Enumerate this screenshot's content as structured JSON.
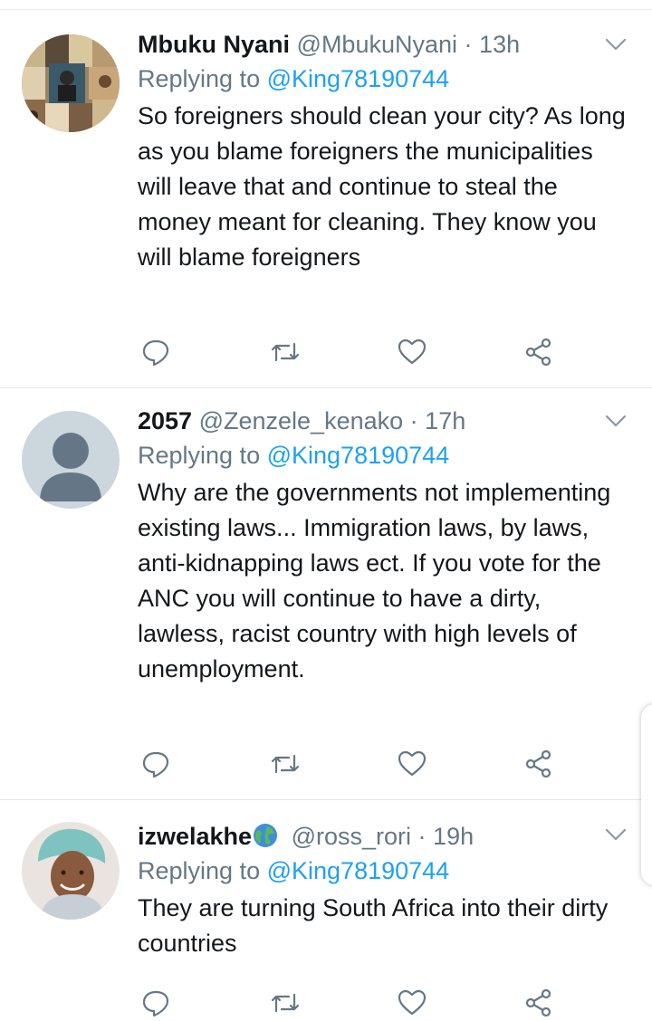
{
  "colors": {
    "link": "#1da1f2",
    "secondary_text": "#657786",
    "primary_text": "#14171a",
    "divider": "#e1e8ed"
  },
  "icons": {
    "reply": "reply-icon",
    "retweet": "retweet-icon",
    "like": "heart-icon",
    "share": "share-icon",
    "more": "chevron-down-icon"
  },
  "tweets": [
    {
      "name": "Mbuku Nyani",
      "handle": "@MbukuNyani",
      "separator": "·",
      "time": "13h",
      "replying_prefix": "Replying to",
      "replying_to": "@King78190744",
      "text": "So foreigners should clean your city?  As long as you blame foreigners the municipalities will leave that and continue to steal the money meant for cleaning. They know you will blame foreigners"
    },
    {
      "name": "2057",
      "handle": "@Zenzele_kenako",
      "separator": "·",
      "time": "17h",
      "replying_prefix": "Replying to",
      "replying_to": "@King78190744",
      "text": "Why are the governments not implementing existing laws... Immigration laws, by laws, anti-kidnapping laws ect. If you vote for the ANC you will continue to have a dirty, lawless, racist country with high levels of unemployment."
    },
    {
      "name": "izwelakhe",
      "handle": "@ross_rori",
      "separator": "·",
      "time": "19h",
      "replying_prefix": "Replying to",
      "replying_to": "@King78190744",
      "text": "They are turning South Africa into their dirty countries"
    }
  ]
}
